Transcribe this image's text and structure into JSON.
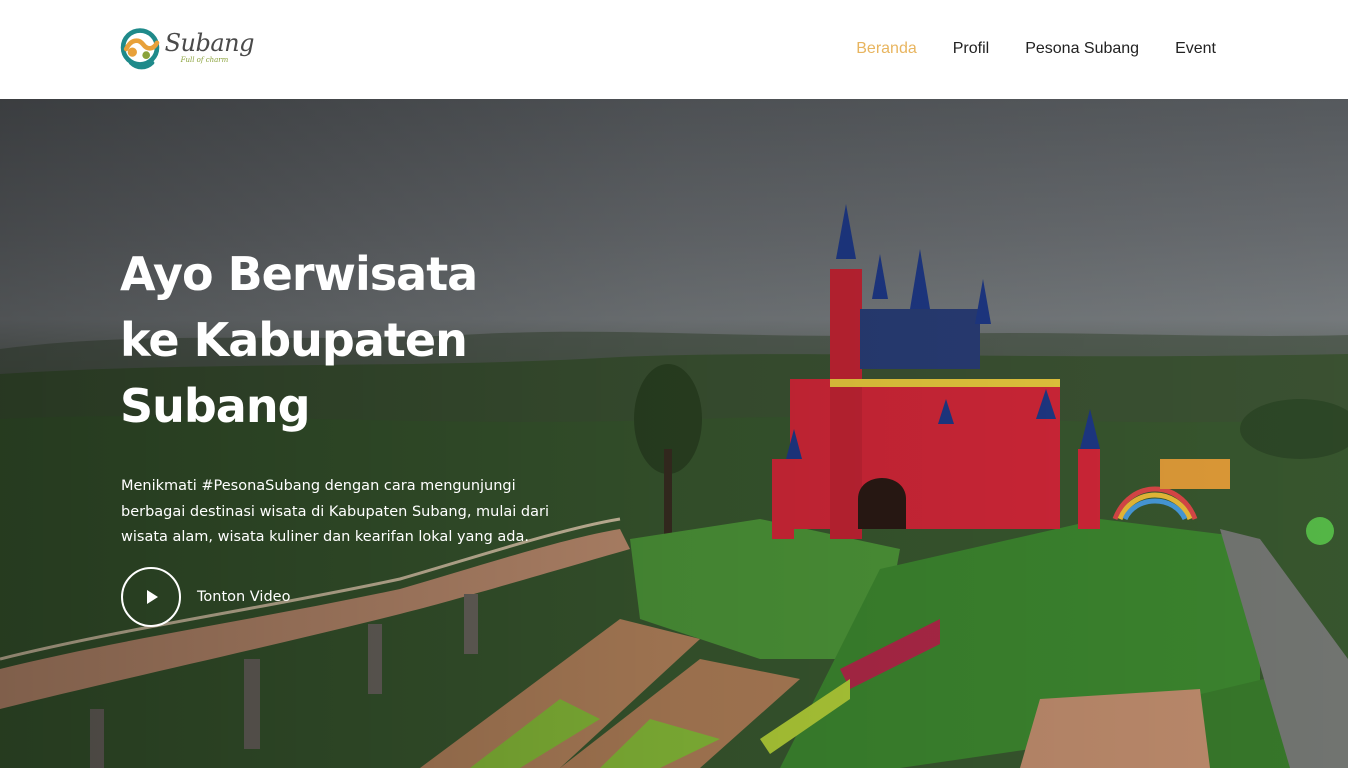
{
  "brand": {
    "name": "Subang",
    "tagline": "Full of charm",
    "colors": {
      "teal": "#1f8a8a",
      "orange": "#e8a13a",
      "green": "#8aa23a"
    }
  },
  "nav": {
    "items": [
      {
        "label": "Beranda",
        "active": true
      },
      {
        "label": "Profil",
        "active": false
      },
      {
        "label": "Pesona Subang",
        "active": false
      },
      {
        "label": "Event",
        "active": false
      }
    ],
    "active_color": "#e8b55f"
  },
  "hero": {
    "title_line1": "Ayo Berwisata",
    "title_line2": "ke Kabupaten",
    "title_line3": "Subang",
    "description": "Menikmati #PesonaSubang dengan cara mengunjungi berbagai destinasi wisata di Kabupaten Subang, mulai dari wisata alam, wisata kuliner dan kearifan lokal yang ada.",
    "video_label": "Tonton Video",
    "play_icon": "play-icon"
  }
}
